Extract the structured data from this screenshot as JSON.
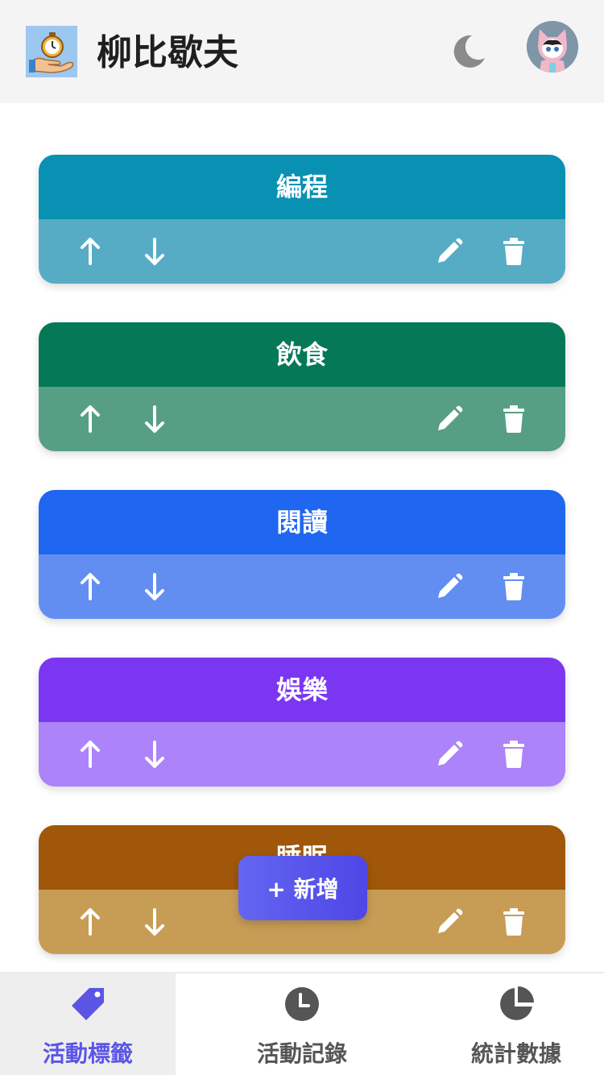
{
  "header": {
    "title": "柳比歇夫",
    "logo_icon": "stopwatch-on-hand-icon",
    "theme_toggle_icon": "moon-icon",
    "avatar_icon": "cat-avatar-icon"
  },
  "tags": [
    {
      "name": "編程",
      "head_color": "#0891b2",
      "body_color": "#56acc4"
    },
    {
      "name": "飲食",
      "head_color": "#047857",
      "body_color": "#579f84"
    },
    {
      "name": "閱讀",
      "head_color": "#1f66f0",
      "body_color": "#628ef1"
    },
    {
      "name": "娛樂",
      "head_color": "#7b36f2",
      "body_color": "#ac83f8"
    },
    {
      "name": "睡眠",
      "head_color": "#a0570a",
      "body_color": "#c79c55"
    }
  ],
  "tag_actions": {
    "icons": [
      "arrow-up-icon",
      "arrow-down-icon",
      "pencil-icon",
      "trash-icon"
    ]
  },
  "add_button": {
    "label": "+ 新增"
  },
  "bottom_nav": {
    "active_color": "#5b55e6",
    "items": [
      {
        "label": "活動標籤",
        "icon": "tag-icon",
        "active": true
      },
      {
        "label": "活動記錄",
        "icon": "clock-icon",
        "active": false
      },
      {
        "label": "統計數據",
        "icon": "pie-chart-icon",
        "active": false
      }
    ]
  }
}
